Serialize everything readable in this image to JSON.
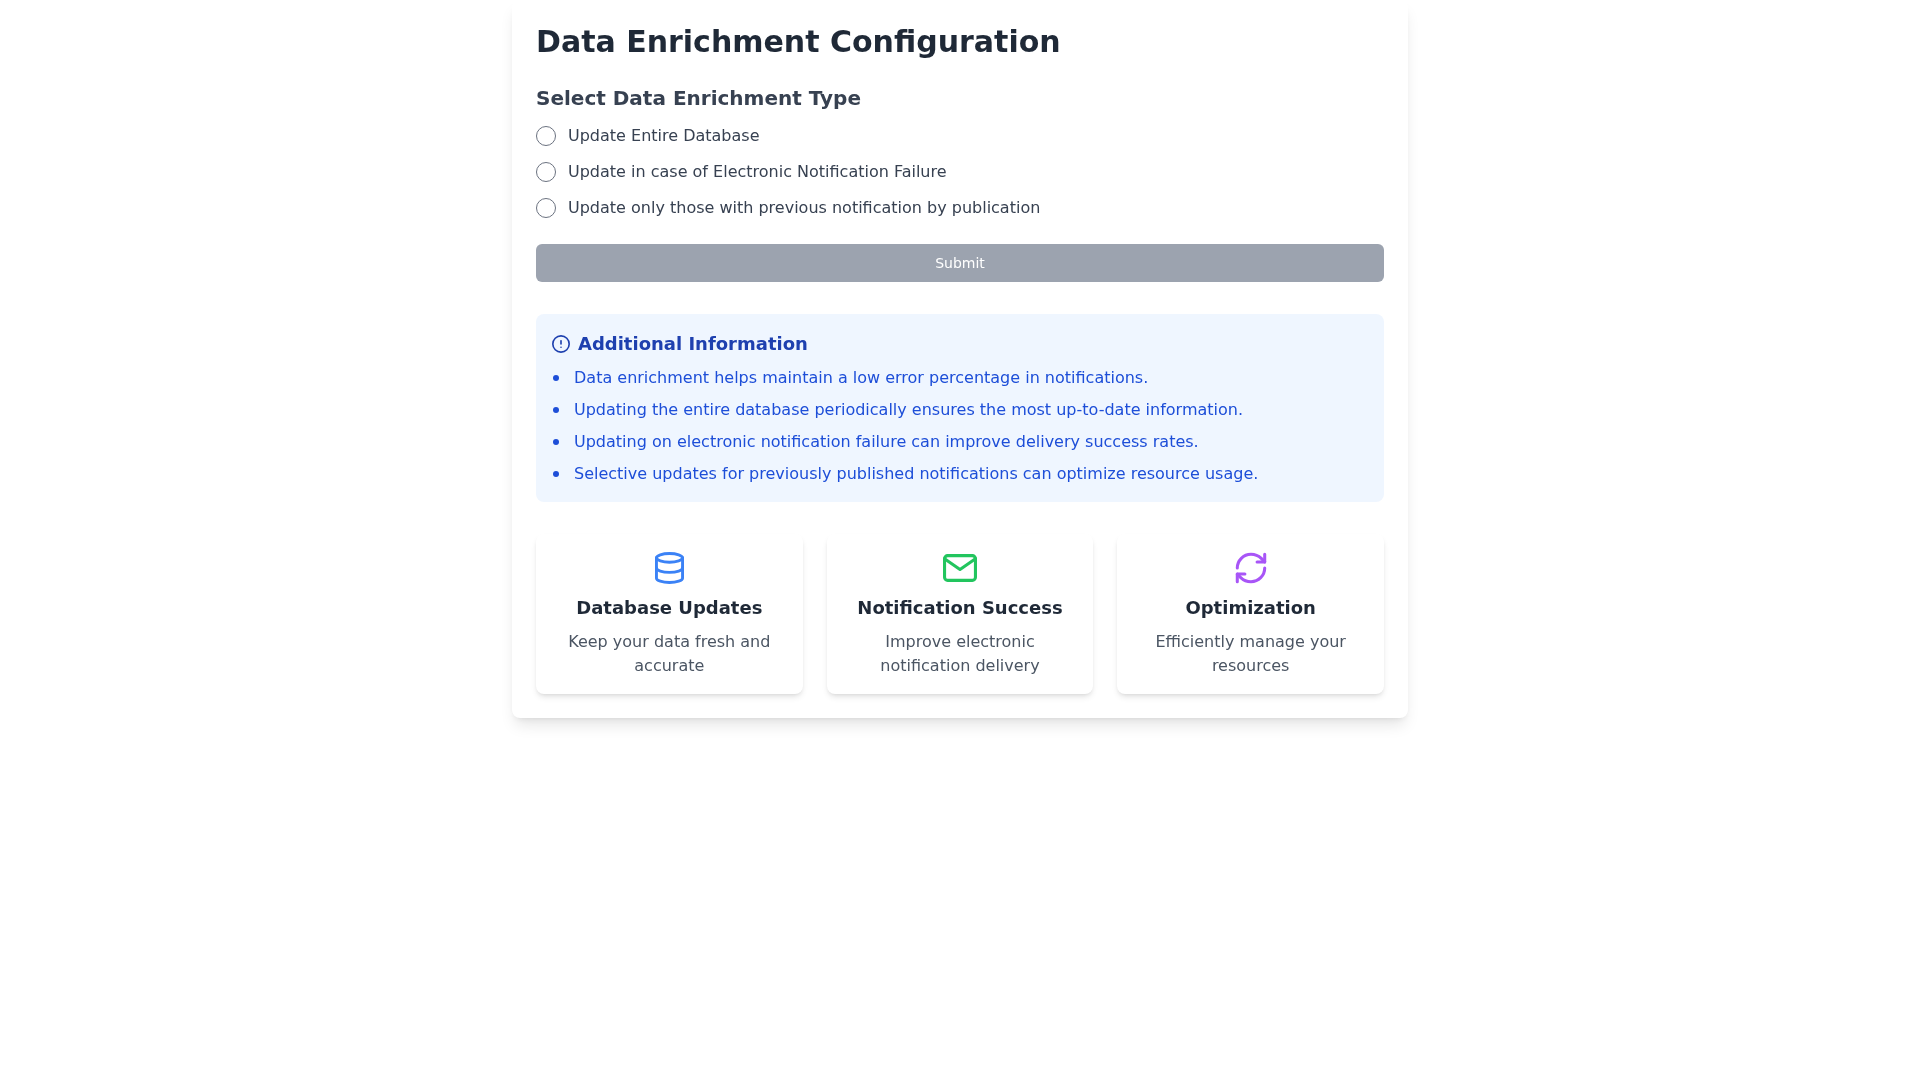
{
  "title": "Data Enrichment Configuration",
  "enrichment_type": {
    "heading": "Select Data Enrichment Type",
    "options": [
      {
        "label": "Update Entire Database",
        "selected": false
      },
      {
        "label": "Update in case of Electronic Notification Failure",
        "selected": false
      },
      {
        "label": "Update only those with previous notification by publication",
        "selected": false
      }
    ]
  },
  "submit_button": {
    "label": "Submit",
    "disabled": true
  },
  "additional_info": {
    "title": "Additional Information",
    "items": [
      "Data enrichment helps maintain a low error percentage in notifications.",
      "Updating the entire database periodically ensures the most up-to-date information.",
      "Updating on electronic notification failure can improve delivery success rates.",
      "Selective updates for previously published notifications can optimize resource usage."
    ]
  },
  "feature_cards": [
    {
      "title": "Database Updates",
      "description": "Keep your data fresh and accurate",
      "color": "#3b82f6"
    },
    {
      "title": "Notification Success",
      "description": "Improve electronic notification delivery",
      "color": "#22c55e"
    },
    {
      "title": "Optimization",
      "description": "Efficiently manage your resources",
      "color": "#a855f7"
    }
  ]
}
